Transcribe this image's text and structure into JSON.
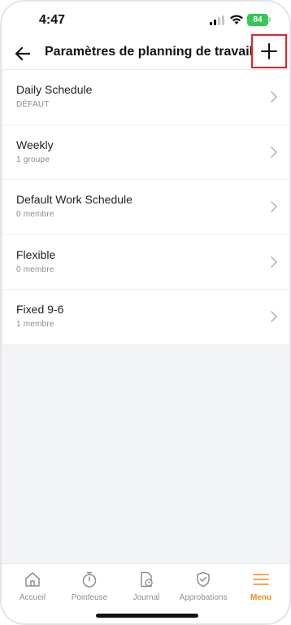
{
  "status": {
    "time": "4:47",
    "battery": "84"
  },
  "header": {
    "title": "Paramètres de planning de travail"
  },
  "list": [
    {
      "title": "Daily Schedule",
      "subtitle": "DÉFAUT"
    },
    {
      "title": "Weekly",
      "subtitle": "1 groupe"
    },
    {
      "title": "Default Work Schedule",
      "subtitle": "0 membre"
    },
    {
      "title": "Flexible",
      "subtitle": "0 membre"
    },
    {
      "title": "Fixed 9-6",
      "subtitle": "1 membre"
    }
  ],
  "tabs": [
    {
      "label": "Accueil",
      "icon": "home-icon"
    },
    {
      "label": "Pointeuse",
      "icon": "stopwatch-icon"
    },
    {
      "label": "Journal",
      "icon": "journal-icon"
    },
    {
      "label": "Approbations",
      "icon": "shield-check-icon"
    },
    {
      "label": "Menu",
      "icon": "menu-icon",
      "active": true
    }
  ],
  "colors": {
    "accent": "#f08c1a",
    "highlight": "#e0262a",
    "battery": "#34c759"
  }
}
